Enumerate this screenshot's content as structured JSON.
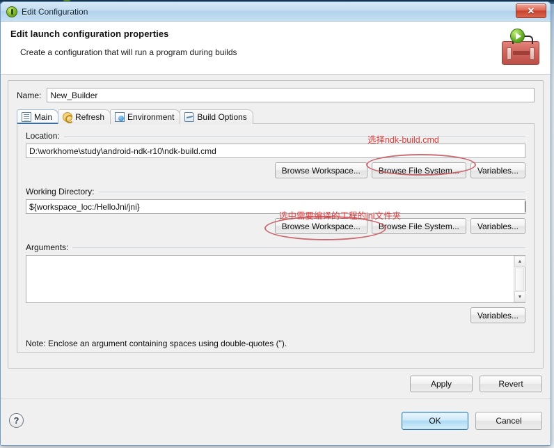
{
  "window": {
    "title": "Edit Configuration",
    "title_icon": "green-run-icon",
    "close_label": "✕"
  },
  "header": {
    "heading": "Edit launch configuration properties",
    "subheading": "Create a configuration that will run a program during builds",
    "art_icon": "toolbox-with-run-badge"
  },
  "form": {
    "name_label": "Name:",
    "name_value": "New_Builder"
  },
  "tabs": [
    {
      "label": "Main",
      "icon": "document-icon",
      "active": true
    },
    {
      "label": "Refresh",
      "icon": "refresh-icon",
      "active": false
    },
    {
      "label": "Environment",
      "icon": "environment-icon",
      "active": false
    },
    {
      "label": "Build Options",
      "icon": "build-options-icon",
      "active": false
    }
  ],
  "main_tab": {
    "location": {
      "label": "Location:",
      "value": "D:\\workhome\\study\\android-ndk-r10\\ndk-build.cmd",
      "buttons": [
        "Browse Workspace...",
        "Browse File System...",
        "Variables..."
      ]
    },
    "working_directory": {
      "label": "Working Directory:",
      "value": "${workspace_loc:/HelloJni/jni}",
      "buttons": [
        "Browse Workspace...",
        "Browse File System...",
        "Variables..."
      ]
    },
    "arguments": {
      "label": "Arguments:",
      "value": "",
      "buttons": [
        "Variables..."
      ],
      "note": "Note: Enclose an argument containing spaces using double-quotes (\")."
    }
  },
  "actions": {
    "apply": "Apply",
    "revert": "Revert",
    "ok": "OK",
    "cancel": "Cancel",
    "help": "?"
  },
  "annotations": [
    {
      "text": "选择ndk-build.cmd",
      "color": "#e0403f",
      "target": "Browse File System... (Location)"
    },
    {
      "text": "选中需要编译的工程的jni文件夹",
      "color": "#e0403f",
      "target": "Browse Workspace... (Working Directory)"
    }
  ],
  "colors": {
    "annotation_red": "#e0403f",
    "ellipse_red": "#c2525a",
    "titlebar_blue": "#b2d2ea",
    "default_button_blue": "#2c7ab5"
  }
}
